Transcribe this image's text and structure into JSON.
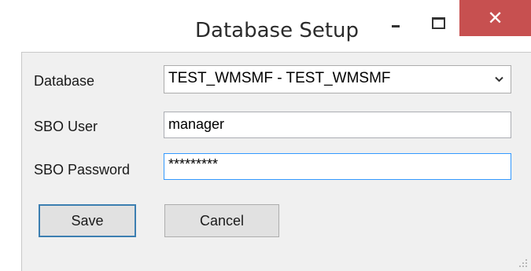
{
  "window": {
    "title": "Database Setup"
  },
  "title_controls": {
    "minimize_icon": "minimize-icon",
    "maximize_icon": "maximize-icon",
    "close_icon": "close-icon",
    "close_glyph": "✕",
    "close_color": "#c75050"
  },
  "form": {
    "database_label": "Database",
    "database_value": "TEST_WMSMF - TEST_WMSMF",
    "sbo_user_label": "SBO User",
    "sbo_user_value": "manager",
    "sbo_password_label": "SBO Password",
    "sbo_password_value": "*********"
  },
  "buttons": {
    "save_label": "Save",
    "cancel_label": "Cancel"
  },
  "colors": {
    "focus_border": "#3399ff",
    "default_button_border": "#3c7fb1"
  }
}
